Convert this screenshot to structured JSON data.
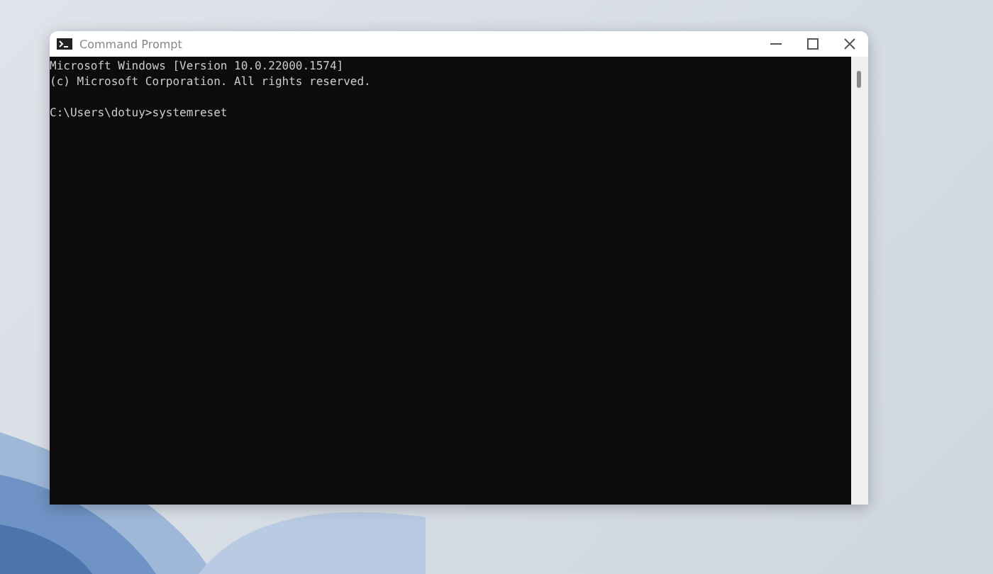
{
  "window": {
    "title": "Command Prompt"
  },
  "console": {
    "output": [
      "Microsoft Windows [Version 10.0.22000.1574]",
      "(c) Microsoft Corporation. All rights reserved."
    ],
    "command_line": "C:\\Users\\dotuy>systemreset"
  }
}
